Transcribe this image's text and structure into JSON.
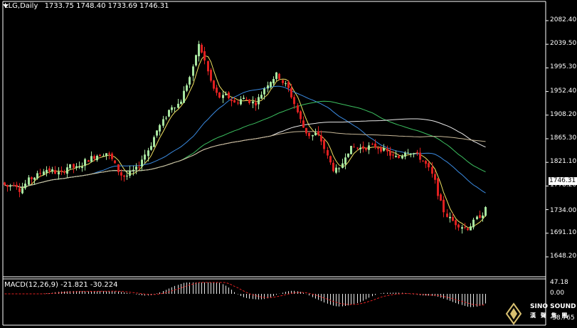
{
  "header": {
    "symbol": "LLG,Daily",
    "ohlc": "1733.75 1748.40 1733.69 1746.31"
  },
  "price_axis": {
    "ticks": [
      "2082.40",
      "2039.50",
      "1995.30",
      "1952.40",
      "1908.20",
      "1865.30",
      "1821.10",
      "1778.20",
      "1734.00",
      "1691.10",
      "1648.20"
    ],
    "current_price": "1746.31"
  },
  "macd": {
    "label": "MACD(12,26,9) -21.821 -30.224",
    "ticks": [
      "47.18",
      "0.00",
      "-38.765"
    ]
  },
  "logo": {
    "name": "SINO SOUND",
    "sub": "漢 聲 集 團"
  },
  "colors": {
    "background": "#000000",
    "bull": "#a8e6a0",
    "bear": "#e02020",
    "ma_fast": "#f0e060",
    "ma_blue": "#3a8ae0",
    "ma_green": "#3cc060",
    "ma_white": "#e8e8e8",
    "ma_tan": "#c8b898",
    "macd_hist": "#e8e8e8",
    "macd_signal": "#e02020"
  }
}
